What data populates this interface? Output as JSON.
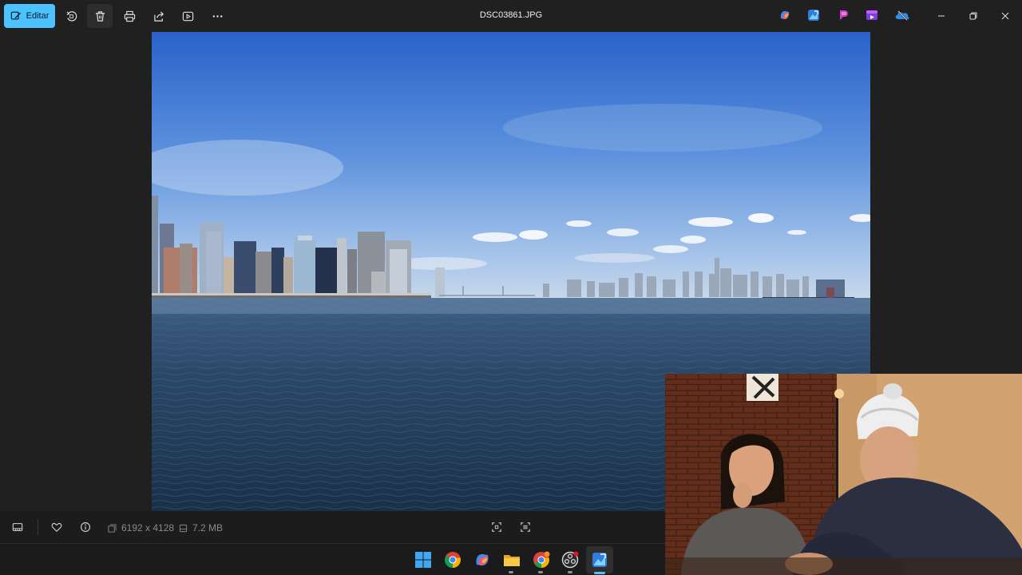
{
  "window": {
    "title": "DSC03861.JPG"
  },
  "toolbar": {
    "edit_label": "Editar",
    "tools": [
      "rotate-icon",
      "delete-icon",
      "print-icon",
      "share-icon",
      "slideshow-icon",
      "more-icon"
    ]
  },
  "title_apps": [
    "copilot-icon",
    "photos-editor-icon",
    "clipchamp-icon",
    "clipchamp-video-icon",
    "onedrive-icon"
  ],
  "status": {
    "dimensions": "6192 x 4128",
    "size": "7.2 MB"
  },
  "taskbar": {
    "apps": [
      "windows-start-icon",
      "chrome-icon",
      "copilot-icon",
      "file-explorer-icon",
      "chrome-profile-icon",
      "obs-icon",
      "photos-icon"
    ]
  },
  "colors": {
    "accent": "#4cc2ff",
    "background": "#202020"
  }
}
